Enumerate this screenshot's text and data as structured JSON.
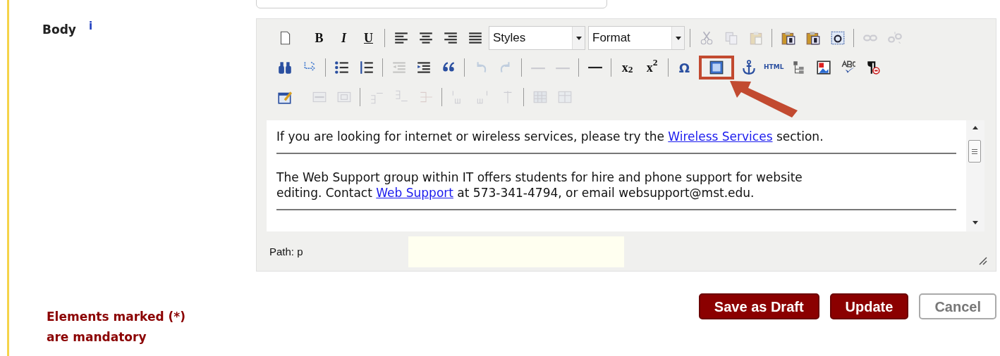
{
  "field": {
    "label": "Body",
    "info": "i"
  },
  "toolbar": [
    [
      {
        "kind": "button",
        "disabled": false,
        "highlighted": false
      },
      {
        "kind": "spacer"
      },
      {
        "kind": "text-button",
        "label": "B",
        "disabled": false,
        "highlighted": false
      },
      {
        "kind": "text-button",
        "label": "I",
        "disabled": false,
        "highlighted": false
      },
      {
        "kind": "text-button",
        "label": "U",
        "disabled": false,
        "highlighted": false
      },
      {
        "kind": "separator"
      },
      {
        "kind": "button",
        "disabled": false,
        "highlighted": false
      },
      {
        "kind": "button",
        "disabled": false,
        "highlighted": false
      },
      {
        "kind": "button",
        "disabled": false,
        "highlighted": false
      },
      {
        "kind": "button",
        "disabled": false,
        "highlighted": false
      },
      {
        "kind": "select",
        "value": "Styles"
      },
      {
        "kind": "select",
        "value": "Format"
      },
      {
        "kind": "separator"
      },
      {
        "kind": "button",
        "disabled": true,
        "highlighted": false
      },
      {
        "kind": "button",
        "disabled": true,
        "highlighted": false
      },
      {
        "kind": "button",
        "disabled": true,
        "highlighted": false
      },
      {
        "kind": "separator"
      },
      {
        "kind": "button",
        "disabled": false,
        "highlighted": false
      },
      {
        "kind": "button",
        "disabled": false,
        "highlighted": false
      },
      {
        "kind": "button",
        "disabled": false,
        "highlighted": false
      },
      {
        "kind": "separator"
      },
      {
        "kind": "button",
        "disabled": true,
        "highlighted": false
      },
      {
        "kind": "button",
        "disabled": true,
        "highlighted": false
      }
    ],
    [
      {
        "kind": "button",
        "disabled": false,
        "highlighted": false
      },
      {
        "kind": "button",
        "disabled": false,
        "highlighted": false
      },
      {
        "kind": "separator"
      },
      {
        "kind": "button",
        "disabled": false,
        "highlighted": false
      },
      {
        "kind": "button",
        "disabled": false,
        "highlighted": false
      },
      {
        "kind": "separator"
      },
      {
        "kind": "button",
        "disabled": true,
        "highlighted": false
      },
      {
        "kind": "button",
        "disabled": false,
        "highlighted": false
      },
      {
        "kind": "button",
        "disabled": false,
        "highlighted": false
      },
      {
        "kind": "separator"
      },
      {
        "kind": "button",
        "disabled": true,
        "highlighted": false
      },
      {
        "kind": "button",
        "disabled": true,
        "highlighted": false
      },
      {
        "kind": "separator"
      },
      {
        "kind": "button",
        "disabled": true,
        "highlighted": false
      },
      {
        "kind": "button",
        "disabled": true,
        "highlighted": false
      },
      {
        "kind": "separator"
      },
      {
        "kind": "button",
        "disabled": false,
        "highlighted": false
      },
      {
        "kind": "separator"
      },
      {
        "kind": "text-button",
        "label": "x$_{2}$",
        "disabled": false,
        "highlighted": false
      },
      {
        "kind": "text-button",
        "label": "x$^{2}$",
        "disabled": false,
        "highlighted": false
      },
      {
        "kind": "separator"
      },
      {
        "kind": "text-button",
        "label": "Ω",
        "disabled": false,
        "highlighted": false
      },
      {
        "kind": "button",
        "disabled": false,
        "highlighted": true
      },
      {
        "kind": "button",
        "disabled": false,
        "highlighted": false
      },
      {
        "kind": "text-button",
        "label": "HTML",
        "disabled": false,
        "highlighted": false
      },
      {
        "kind": "button",
        "disabled": false,
        "highlighted": false
      },
      {
        "kind": "button",
        "disabled": false,
        "highlighted": false
      },
      {
        "kind": "button",
        "disabled": false,
        "highlighted": false
      },
      {
        "kind": "button",
        "disabled": false,
        "highlighted": false
      }
    ],
    [
      {
        "kind": "button",
        "disabled": false,
        "highlighted": false
      },
      {
        "kind": "spacer"
      },
      {
        "kind": "button",
        "disabled": true,
        "highlighted": false
      },
      {
        "kind": "button",
        "disabled": true,
        "highlighted": false
      },
      {
        "kind": "separator"
      },
      {
        "kind": "button",
        "disabled": true,
        "highlighted": false
      },
      {
        "kind": "button",
        "disabled": true,
        "highlighted": false
      },
      {
        "kind": "button",
        "disabled": true,
        "highlighted": false
      },
      {
        "kind": "separator"
      },
      {
        "kind": "button",
        "disabled": true,
        "highlighted": false
      },
      {
        "kind": "button",
        "disabled": true,
        "highlighted": false
      },
      {
        "kind": "button",
        "disabled": true,
        "highlighted": false
      },
      {
        "kind": "separator"
      },
      {
        "kind": "button",
        "disabled": true,
        "highlighted": false
      },
      {
        "kind": "button",
        "disabled": true,
        "highlighted": false
      }
    ]
  ],
  "content": [
    {
      "kind": "paragraph",
      "parts": [
        {
          "kind": "text",
          "text": "If you are looking for internet or wireless services, please try the "
        },
        {
          "kind": "link",
          "text": "Wireless Services"
        },
        {
          "kind": "text",
          "text": " section."
        }
      ]
    },
    {
      "kind": "rule"
    },
    {
      "kind": "paragraph",
      "parts": [
        {
          "kind": "text",
          "text": "The Web Support group within IT offers students for hire and phone support for website editing. Contact "
        },
        {
          "kind": "link",
          "text": "Web Support"
        },
        {
          "kind": "text",
          "text": " at 573-341-4794, or email websupport@mst.edu."
        }
      ]
    },
    {
      "kind": "rule"
    }
  ],
  "path": "Path: p",
  "notice": "Elements marked (*) are mandatory",
  "buttons": [
    {
      "label": "Save as Draft",
      "kind": "primary"
    },
    {
      "label": "Update",
      "kind": "primary"
    },
    {
      "label": "Cancel",
      "kind": "secondary"
    }
  ]
}
